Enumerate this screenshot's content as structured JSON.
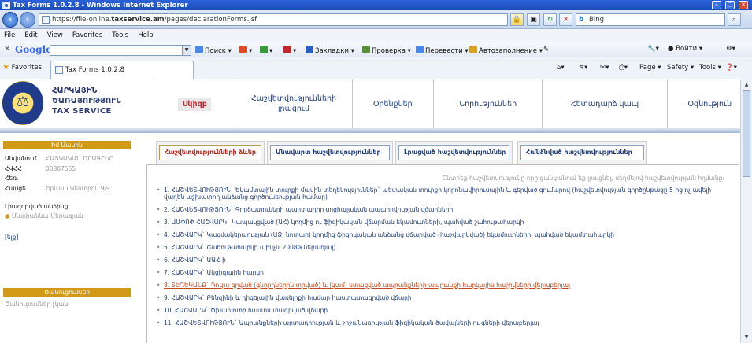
{
  "window": {
    "title": "Tax Forms 1.0.2.8 - Windows Internet Explorer",
    "min": "–",
    "max": "□",
    "close": "✕"
  },
  "address": {
    "url_prefix": "https://file-online.",
    "url_domain": "taxservice.am",
    "url_path": "/pages/declarationForms.jsf",
    "search_placeholder": "Bing"
  },
  "menu": [
    "File",
    "Edit",
    "View",
    "Favorites",
    "Tools",
    "Help"
  ],
  "google_toolbar": {
    "logo": "Google",
    "search": "Поиск",
    "bookmarks": "Закладки",
    "spell": "Проверка",
    "translate": "Перевести",
    "autofill": "Автозаполнение",
    "signin": "Войти"
  },
  "favorites_bar": {
    "favorites": "Favorites",
    "tab_title": "Tax Forms 1.0.2.8",
    "page_menu": "Page",
    "safety_menu": "Safety",
    "tools_menu": "Tools"
  },
  "site": {
    "logo_line1": "ՀԱՐԿԱՅԻՆ",
    "logo_line2": "ԾԱՌԱՅՈՒԹՅՈՒՆ",
    "logo_line3": "TAX SERVICE",
    "nav": [
      "Սկիզբ",
      "Հաշվետվությունների լրացում",
      "Օրենքներ",
      "Նորություններ",
      "Հետադարձ կապ",
      "Օգնություն"
    ]
  },
  "sidebar": {
    "profile_title": "Իմ Մասին",
    "fields": [
      {
        "label": "Անվանում",
        "value": "ՀԱՅԿԱԿԱՆ ԾՐԱԳՐԵՐ"
      },
      {
        "label": "ՀՎՀՀ",
        "value": "00807555"
      },
      {
        "label": "Հեռ.",
        "value": ""
      },
      {
        "label": "Հասցե",
        "value": "Երևան Կենտրոն 9/9"
      }
    ],
    "contact_label": "Լիազորված անձինք",
    "contact_name": "Մարիաննա Մերազյան",
    "help_link": "[ելք]",
    "messages_title": "Ծանուցումներ",
    "messages_empty": "Ծանուցումներ չկան"
  },
  "content": {
    "tabs": [
      "Հաշվետվությունների ձևեր",
      "Անավարտ հաշվետվություններ",
      "Լրացված հաշվետվություններ",
      "Հանձնված հաշվետվություններ"
    ],
    "hint": "Ընտրեք հաշվետվությունը որը ցանկանում եք լրացնել, սեղմելով հաշվետվության հղմանը:",
    "documents": [
      "1. ՀԱՇՎԵՏՎՈՒԹՅՈՒՆ` Եկամտային տուրքի մասին տեղեկություններ` պետական տուրքի կորոնավիրուսային և գերված գումարով (հաշվետվության գործընթացը 5-ից ոչ ավելի վաղեն աշխատող անձանց գործունեության համար)",
      "2. ՀԱՇՎԵՏՎՈՒԹՅՈՒՆ` Գործատուների պարտադիր սոցիալական ապահովության վճարների",
      "3. ԱՄՓՈՓ ՀԱՇՎԱՐԿ` Կապակցված (ԱՀ) կողմից ու ֆիզիկական վճարման եկամուտների, պահված շահութահարկի",
      "4. ՀԱՇՎԱՐԿ` Կազմակերպության (ԱՁ, նոտար) կողմից ֆիզիկական անձանց վճարված (հաշվարկված) եկամուտների, պահված եկամտահարկի",
      "5. ՀԱՇՎԱՐԿ` Շահութահարկի (մինչև 2008թ ներառյալ)",
      "6. ՀԱՇՎԱՐԿ` ԱԱՀ-ի",
      "7. ՀԱՇՎԱՐԿ` Ակցիզային հարկի",
      "8. ՏԵՂԵԿԱՆՔ` Դուրս գրված (գնորդներին տրված) և (կամ) ստացված ապրանքների ապրանքի հարկային հաշիվների վերաբերյալ",
      "9. ՀԱՇՎԱՐԿ` Բենզինի և դիզելային վառելիքի համար հաստատագրված վճարի",
      "10. ՀԱՇՎԱՐԿ` Ծխախոտի հաստատագրված վճարի",
      "11. ՀԱՇՎԵՏՎՈՒԹՅՈՒՆ` Ապրանքների արտադրության և շրջանառության ֆիզիկական ծավալների ու գների վերաբերյալ"
    ]
  },
  "colors": {
    "sidebar_header": "#d19a16",
    "nav_active": "#c0282c",
    "link": "#1f3d7a",
    "highlight_link": "#c24a1c"
  }
}
